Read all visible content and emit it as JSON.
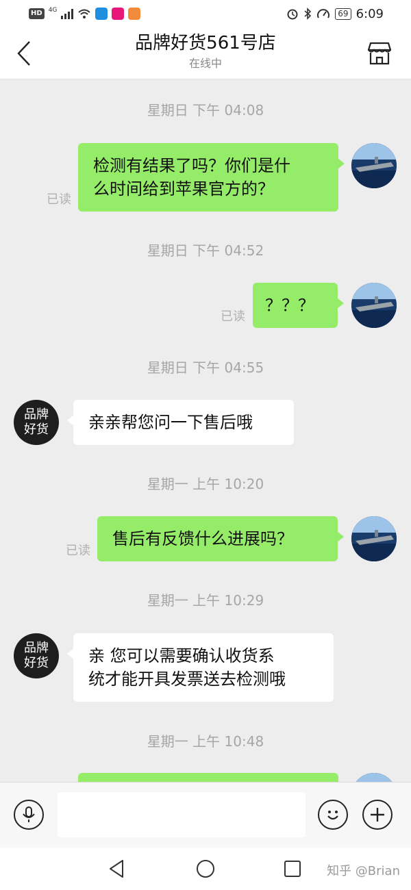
{
  "status_bar": {
    "hd": "HD",
    "network": "4G",
    "battery": "69",
    "time": "6:09",
    "app_icon_colors": [
      "#1e8fe0",
      "#e8187a",
      "#f28b3a"
    ]
  },
  "header": {
    "title": "品牌好货561号店",
    "subtitle": "在线中",
    "back_icon": "chevron-left-icon",
    "shop_icon": "storefront-icon"
  },
  "messages": [
    {
      "type": "timestamp",
      "text": "星期日 下午 04:08"
    },
    {
      "type": "sent",
      "lines": [
        "检测有结果了吗？你们是什",
        "么时间给到苹果官方的？"
      ],
      "read": "已读"
    },
    {
      "type": "timestamp",
      "text": "星期日 下午 04:52"
    },
    {
      "type": "sent",
      "lines": [
        "？？？"
      ],
      "read": "已读"
    },
    {
      "type": "timestamp",
      "text": "星期日 下午 04:55"
    },
    {
      "type": "received",
      "lines": [
        "亲亲帮您问一下售后哦"
      ]
    },
    {
      "type": "timestamp",
      "text": "星期一 上午 10:20"
    },
    {
      "type": "sent",
      "lines": [
        "售后有反馈什么进展吗？"
      ],
      "read": "已读"
    },
    {
      "type": "timestamp",
      "text": "星期一 上午 10:29"
    },
    {
      "type": "received",
      "lines": [
        "亲 您可以需要确认收货系",
        "统才能开具发票送去检测哦"
      ]
    },
    {
      "type": "timestamp",
      "text": "星期一 上午 10:48"
    }
  ],
  "brand_avatar": {
    "line1": "品牌",
    "line2": "好货"
  },
  "input": {
    "placeholder": "",
    "value": ""
  },
  "watermark": "知乎 @Brian",
  "colors": {
    "sent_bubble": "#95ec69",
    "received_bubble": "#ffffff",
    "background": "#ededed"
  }
}
